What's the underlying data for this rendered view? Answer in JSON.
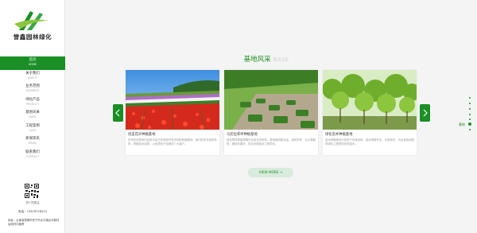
{
  "brand": {
    "name": "誉鑫园林绿化"
  },
  "nav": {
    "items": [
      {
        "zh": "首页",
        "en": "HOME"
      },
      {
        "zh": "关于我们",
        "en": "ABOUT"
      },
      {
        "zh": "业务范围",
        "en": "BUSINESS"
      },
      {
        "zh": "绿化产品",
        "en": "PRODUCT"
      },
      {
        "zh": "基地风采",
        "en": "BASE"
      },
      {
        "zh": "工程案例",
        "en": "CASE"
      },
      {
        "zh": "新闻资讯",
        "en": "NEWS"
      },
      {
        "zh": "联系我们",
        "en": "CONTACT"
      }
    ]
  },
  "contact": {
    "qr_label": "扫一扫关注",
    "phone": "电话：13676726014",
    "address": "地址：云南省昆明市安宁市太平镇太平新村后街村口路旁"
  },
  "section": {
    "title": "基地风采",
    "title_en": "BASE"
  },
  "cards": [
    {
      "title": "创造花卉种植基地",
      "desc": "好货在线是我们目前今后已有规划开拓市场的种植基地，我们的花卉品种多样，种植技术成熟，以优质的产品服务广大客户。"
    },
    {
      "title": "马尼拉草坪种植基地",
      "desc": "绿化草坪种植规模在全省名列前茅，基地面积数百亩，品种多样，生长周期短，铺设效果好，供应全国各地工程项目。"
    },
    {
      "title": "绿化苗木种植基地",
      "desc": "苗木种植基地引进多个优良品种，苗木规格齐全，长势良好，为全省各地园林绿化工程提供优质苗木。"
    }
  ],
  "view_more": "VIEW MORE →",
  "side_dots": {
    "active_label": "基地"
  },
  "colors": {
    "accent": "#1a8f25"
  }
}
